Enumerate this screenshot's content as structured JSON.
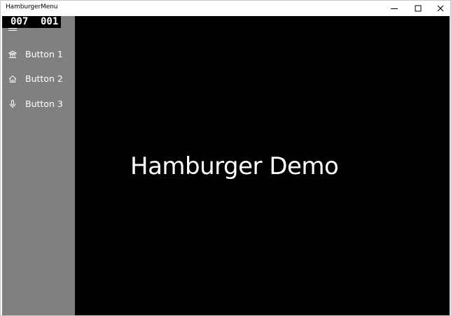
{
  "window": {
    "title": "HamburgerMenu"
  },
  "counter": {
    "first": "007",
    "second": "001"
  },
  "nav": {
    "items": [
      {
        "label": "Button 1",
        "icon": "museum-icon"
      },
      {
        "label": "Button 2",
        "icon": "home-icon"
      },
      {
        "label": "Button 3",
        "icon": "microphone-icon"
      }
    ]
  },
  "main": {
    "heading": "Hamburger Demo"
  },
  "colors": {
    "pane": "#808080",
    "content_background": "#000000",
    "text": "#ffffff"
  }
}
